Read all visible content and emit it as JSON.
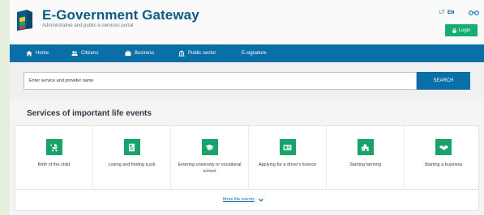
{
  "header": {
    "title": "E-Government Gateway",
    "subtitle": "Administrative and public e-services portal",
    "lang_lt": "LT",
    "lang_en": "EN",
    "login_label": "Login",
    "icons": {
      "logo": "portal-logo-icon",
      "accessibility": "glasses-icon",
      "login": "lock-icon"
    }
  },
  "nav": {
    "items": [
      {
        "label": "Home",
        "icon": "home-icon"
      },
      {
        "label": "Citizens",
        "icon": "people-icon"
      },
      {
        "label": "Business",
        "icon": "briefcase-icon"
      },
      {
        "label": "Public sector",
        "icon": "building-icon"
      },
      {
        "label": "E-signature",
        "icon": ""
      }
    ]
  },
  "search": {
    "placeholder": "Enter service and provider name",
    "button_label": "SEARCH"
  },
  "life_events": {
    "title": "Services of important life events",
    "cards": [
      {
        "label": "Birth of the child",
        "icon": "stroller-icon"
      },
      {
        "label": "Losing and finding a job",
        "icon": "document-icon"
      },
      {
        "label": "Entering university or vocational school",
        "icon": "graduation-cap-icon"
      },
      {
        "label": "Applying for a driver's licence",
        "icon": "id-card-icon"
      },
      {
        "label": "Starting farming",
        "icon": "tractor-icon"
      },
      {
        "label": "Starting a business",
        "icon": "handshake-icon"
      }
    ],
    "more_label": "More life events"
  },
  "colors": {
    "brand_blue": "#0a6fa6",
    "title_blue": "#0b5a86",
    "accent_green": "#18a36a",
    "login_green": "#15ad72",
    "frame_green": "#e4f0dc"
  }
}
